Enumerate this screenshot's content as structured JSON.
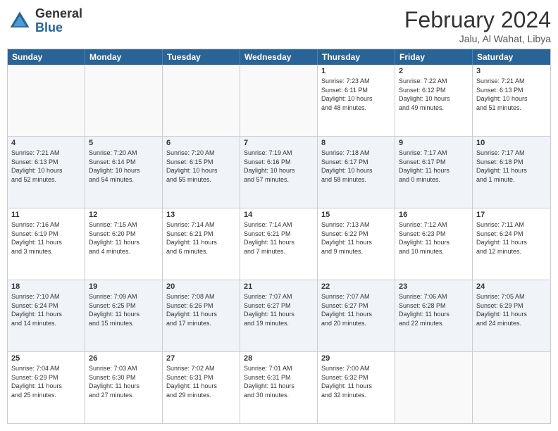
{
  "logo": {
    "general": "General",
    "blue": "Blue"
  },
  "title": "February 2024",
  "subtitle": "Jalu, Al Wahat, Libya",
  "days": [
    "Sunday",
    "Monday",
    "Tuesday",
    "Wednesday",
    "Thursday",
    "Friday",
    "Saturday"
  ],
  "rows": [
    [
      {
        "day": "",
        "info": "",
        "empty": true
      },
      {
        "day": "",
        "info": "",
        "empty": true
      },
      {
        "day": "",
        "info": "",
        "empty": true
      },
      {
        "day": "",
        "info": "",
        "empty": true
      },
      {
        "day": "1",
        "info": "Sunrise: 7:23 AM\nSunset: 6:11 PM\nDaylight: 10 hours\nand 48 minutes.",
        "empty": false
      },
      {
        "day": "2",
        "info": "Sunrise: 7:22 AM\nSunset: 6:12 PM\nDaylight: 10 hours\nand 49 minutes.",
        "empty": false
      },
      {
        "day": "3",
        "info": "Sunrise: 7:21 AM\nSunset: 6:13 PM\nDaylight: 10 hours\nand 51 minutes.",
        "empty": false
      }
    ],
    [
      {
        "day": "4",
        "info": "Sunrise: 7:21 AM\nSunset: 6:13 PM\nDaylight: 10 hours\nand 52 minutes.",
        "empty": false
      },
      {
        "day": "5",
        "info": "Sunrise: 7:20 AM\nSunset: 6:14 PM\nDaylight: 10 hours\nand 54 minutes.",
        "empty": false
      },
      {
        "day": "6",
        "info": "Sunrise: 7:20 AM\nSunset: 6:15 PM\nDaylight: 10 hours\nand 55 minutes.",
        "empty": false
      },
      {
        "day": "7",
        "info": "Sunrise: 7:19 AM\nSunset: 6:16 PM\nDaylight: 10 hours\nand 57 minutes.",
        "empty": false
      },
      {
        "day": "8",
        "info": "Sunrise: 7:18 AM\nSunset: 6:17 PM\nDaylight: 10 hours\nand 58 minutes.",
        "empty": false
      },
      {
        "day": "9",
        "info": "Sunrise: 7:17 AM\nSunset: 6:17 PM\nDaylight: 11 hours\nand 0 minutes.",
        "empty": false
      },
      {
        "day": "10",
        "info": "Sunrise: 7:17 AM\nSunset: 6:18 PM\nDaylight: 11 hours\nand 1 minute.",
        "empty": false
      }
    ],
    [
      {
        "day": "11",
        "info": "Sunrise: 7:16 AM\nSunset: 6:19 PM\nDaylight: 11 hours\nand 3 minutes.",
        "empty": false
      },
      {
        "day": "12",
        "info": "Sunrise: 7:15 AM\nSunset: 6:20 PM\nDaylight: 11 hours\nand 4 minutes.",
        "empty": false
      },
      {
        "day": "13",
        "info": "Sunrise: 7:14 AM\nSunset: 6:21 PM\nDaylight: 11 hours\nand 6 minutes.",
        "empty": false
      },
      {
        "day": "14",
        "info": "Sunrise: 7:14 AM\nSunset: 6:21 PM\nDaylight: 11 hours\nand 7 minutes.",
        "empty": false
      },
      {
        "day": "15",
        "info": "Sunrise: 7:13 AM\nSunset: 6:22 PM\nDaylight: 11 hours\nand 9 minutes.",
        "empty": false
      },
      {
        "day": "16",
        "info": "Sunrise: 7:12 AM\nSunset: 6:23 PM\nDaylight: 11 hours\nand 10 minutes.",
        "empty": false
      },
      {
        "day": "17",
        "info": "Sunrise: 7:11 AM\nSunset: 6:24 PM\nDaylight: 11 hours\nand 12 minutes.",
        "empty": false
      }
    ],
    [
      {
        "day": "18",
        "info": "Sunrise: 7:10 AM\nSunset: 6:24 PM\nDaylight: 11 hours\nand 14 minutes.",
        "empty": false
      },
      {
        "day": "19",
        "info": "Sunrise: 7:09 AM\nSunset: 6:25 PM\nDaylight: 11 hours\nand 15 minutes.",
        "empty": false
      },
      {
        "day": "20",
        "info": "Sunrise: 7:08 AM\nSunset: 6:26 PM\nDaylight: 11 hours\nand 17 minutes.",
        "empty": false
      },
      {
        "day": "21",
        "info": "Sunrise: 7:07 AM\nSunset: 6:27 PM\nDaylight: 11 hours\nand 19 minutes.",
        "empty": false
      },
      {
        "day": "22",
        "info": "Sunrise: 7:07 AM\nSunset: 6:27 PM\nDaylight: 11 hours\nand 20 minutes.",
        "empty": false
      },
      {
        "day": "23",
        "info": "Sunrise: 7:06 AM\nSunset: 6:28 PM\nDaylight: 11 hours\nand 22 minutes.",
        "empty": false
      },
      {
        "day": "24",
        "info": "Sunrise: 7:05 AM\nSunset: 6:29 PM\nDaylight: 11 hours\nand 24 minutes.",
        "empty": false
      }
    ],
    [
      {
        "day": "25",
        "info": "Sunrise: 7:04 AM\nSunset: 6:29 PM\nDaylight: 11 hours\nand 25 minutes.",
        "empty": false
      },
      {
        "day": "26",
        "info": "Sunrise: 7:03 AM\nSunset: 6:30 PM\nDaylight: 11 hours\nand 27 minutes.",
        "empty": false
      },
      {
        "day": "27",
        "info": "Sunrise: 7:02 AM\nSunset: 6:31 PM\nDaylight: 11 hours\nand 29 minutes.",
        "empty": false
      },
      {
        "day": "28",
        "info": "Sunrise: 7:01 AM\nSunset: 6:31 PM\nDaylight: 11 hours\nand 30 minutes.",
        "empty": false
      },
      {
        "day": "29",
        "info": "Sunrise: 7:00 AM\nSunset: 6:32 PM\nDaylight: 11 hours\nand 32 minutes.",
        "empty": false
      },
      {
        "day": "",
        "info": "",
        "empty": true
      },
      {
        "day": "",
        "info": "",
        "empty": true
      }
    ]
  ]
}
